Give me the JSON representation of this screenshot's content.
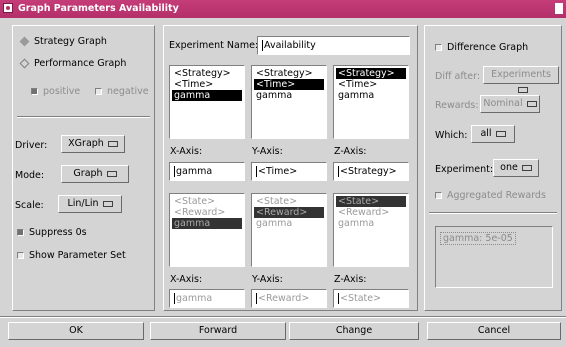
{
  "window": {
    "title": "Graph Parameters  Availability"
  },
  "left": {
    "graph_type": [
      {
        "label": "Strategy Graph",
        "selected": true
      },
      {
        "label": "Performance Graph",
        "selected": false
      }
    ],
    "positive_label": "positive",
    "negative_label": "negative",
    "driver_label": "Driver:",
    "driver_value": "XGraph",
    "mode_label": "Mode:",
    "mode_value": "Graph",
    "scale_label": "Scale:",
    "scale_value": "Lin/Lin",
    "suppress_label": "Suppress 0s",
    "show_param_label": "Show Parameter Set"
  },
  "middle": {
    "experiment_name_label": "Experiment Name:",
    "experiment_name_value": "Availability",
    "top_lists": [
      {
        "items": [
          "<Strategy>",
          "<Time>",
          "gamma"
        ],
        "selected": 2
      },
      {
        "items": [
          "<Strategy>",
          "<Time>",
          "gamma"
        ],
        "selected": 1
      },
      {
        "items": [
          "<Strategy>",
          "<Time>",
          "gamma"
        ],
        "selected": 0
      }
    ],
    "top_axes": [
      {
        "label": "X-Axis:",
        "value": "gamma"
      },
      {
        "label": "Y-Axis:",
        "value": "<Time>"
      },
      {
        "label": "Z-Axis:",
        "value": "<Strategy>"
      }
    ],
    "bottom_lists": [
      {
        "items": [
          "<State>",
          "<Reward>",
          "gamma"
        ],
        "selected": 2
      },
      {
        "items": [
          "<State>",
          "<Reward>",
          "gamma"
        ],
        "selected": 1
      },
      {
        "items": [
          "<State>",
          "<Reward>",
          "gamma"
        ],
        "selected": 0
      }
    ],
    "bottom_axes": [
      {
        "label": "X-Axis:",
        "value": "gamma"
      },
      {
        "label": "Y-Axis:",
        "value": "<Reward>"
      },
      {
        "label": "Z-Axis:",
        "value": "<State>"
      }
    ]
  },
  "right": {
    "difference_label": "Difference Graph",
    "diff_after_label": "Diff after:",
    "diff_after_value": "Experiments",
    "rewards_label": "Rewards:",
    "rewards_value": "Nominal",
    "which_label": "Which:",
    "which_value": "all",
    "experiment_label": "Experiment:",
    "experiment_value": "one",
    "aggregated_label": "Aggregated Rewards",
    "param_text": "gamma: 5e-05"
  },
  "buttons": {
    "ok": "OK",
    "forward": "Forward",
    "change": "Change",
    "cancel": "Cancel"
  }
}
